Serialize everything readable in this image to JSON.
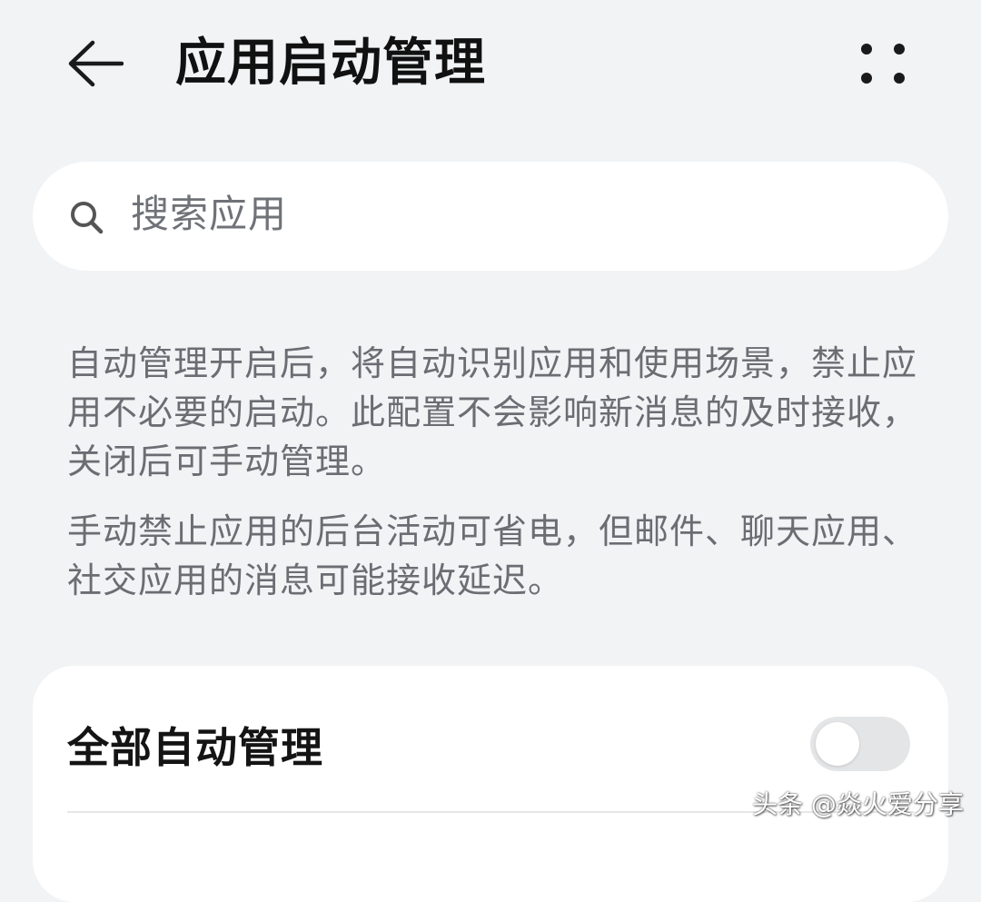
{
  "header": {
    "title": "应用启动管理",
    "back_icon": "arrow-left-icon",
    "more_icon": "more-dots-icon"
  },
  "search": {
    "placeholder": "搜索应用",
    "icon": "search-icon"
  },
  "description": {
    "paragraph_1": "自动管理开启后，将自动识别应用和使用场景，禁止应用不必要的启动。此配置不会影响新消息的及时接收，关闭后可手动管理。",
    "paragraph_2": "手动禁止应用的后台活动可省电，但邮件、聊天应用、社交应用的消息可能接收延迟。"
  },
  "settings": {
    "auto_manage_all_label": "全部自动管理",
    "auto_manage_all_enabled": false
  },
  "watermark": {
    "text": "头条 @焱火爱分享"
  },
  "colors": {
    "background": "#f1f3f5",
    "card": "#ffffff",
    "toggle_off": "#e4e5e7",
    "secondary_text": "#6a6d72"
  }
}
